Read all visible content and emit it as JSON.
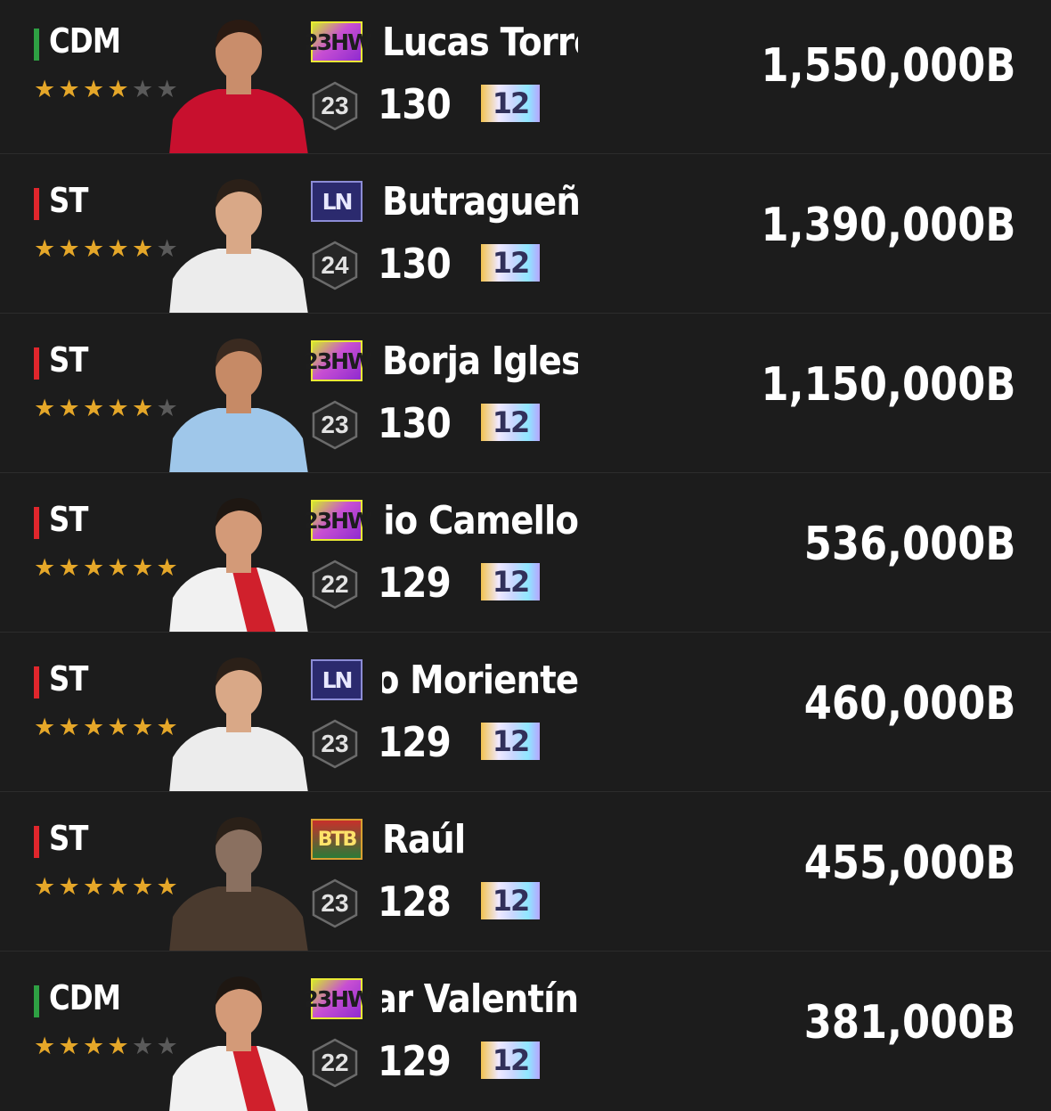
{
  "colors": {
    "cdm": "#2ea043",
    "st": "#e0262c",
    "star_on": "#e5a729",
    "star_off": "#5a5a5a"
  },
  "players": [
    {
      "position": "CDM",
      "stars": 4,
      "season": "23HW",
      "season_style": "hw",
      "name": "Lucas Torró",
      "name_cut": false,
      "level": "23",
      "ovr": "130",
      "upgrade": "12",
      "price": "1,550,000B",
      "kit": "osasuna"
    },
    {
      "position": "ST",
      "stars": 5,
      "season": "LN",
      "season_style": "ln",
      "name": "Butragueño",
      "name_cut": false,
      "level": "24",
      "ovr": "130",
      "upgrade": "12",
      "price": "1,390,000B",
      "kit": "white"
    },
    {
      "position": "ST",
      "stars": 5,
      "season": "23HW",
      "season_style": "hw",
      "name": "Borja Iglesias",
      "name_cut": false,
      "level": "23",
      "ovr": "130",
      "upgrade": "12",
      "price": "1,150,000B",
      "kit": "celta"
    },
    {
      "position": "ST",
      "stars": 6,
      "season": "23HW",
      "season_style": "hw",
      "name": "ergio Camello",
      "name_cut": true,
      "level": "22",
      "ovr": "129",
      "upgrade": "12",
      "price": "536,000B",
      "kit": "rayo"
    },
    {
      "position": "ST",
      "stars": 6,
      "season": "LN",
      "season_style": "ln",
      "name": "ndo Moriente",
      "name_cut": true,
      "level": "23",
      "ovr": "129",
      "upgrade": "12",
      "price": "460,000B",
      "kit": "white"
    },
    {
      "position": "ST",
      "stars": 6,
      "season": "BTB",
      "season_style": "btb",
      "name": "Raúl",
      "name_cut": false,
      "level": "23",
      "ovr": "128",
      "upgrade": "12",
      "price": "455,000B",
      "kit": "sepia"
    },
    {
      "position": "CDM",
      "stars": 4,
      "season": "23HW",
      "season_style": "hw",
      "name": "scar Valentín",
      "name_cut": true,
      "level": "22",
      "ovr": "129",
      "upgrade": "12",
      "price": "381,000B",
      "kit": "rayo"
    }
  ]
}
